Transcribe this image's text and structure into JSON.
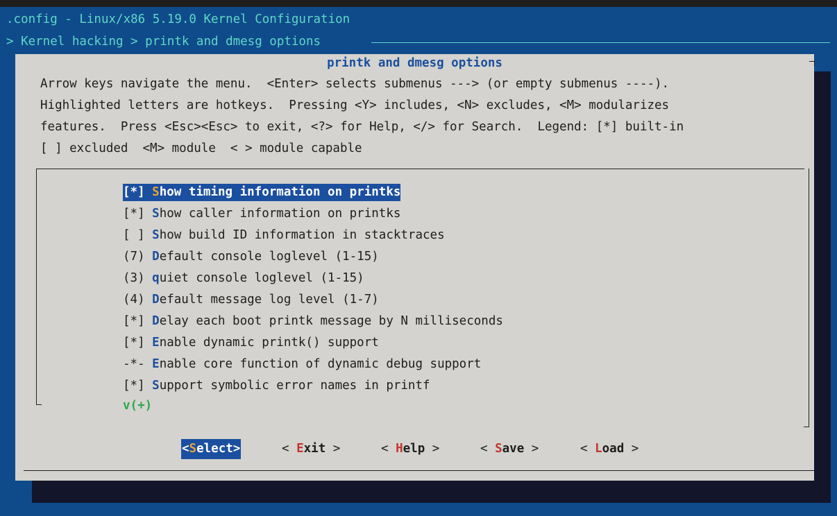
{
  "window": {
    "title": ".config - Linux/x86 5.19.0 Kernel Configuration",
    "breadcrumb": "> Kernel hacking > printk and dmesg options"
  },
  "dialog": {
    "title": "printk and dmesg options",
    "help_lines": [
      "Arrow keys navigate the menu.  <Enter> selects submenus ---> (or empty submenus ----).",
      "Highlighted letters are hotkeys.  Pressing <Y> includes, <N> excludes, <M> modularizes",
      "features.  Press <Esc><Esc> to exit, <?> for Help, </> for Search.  Legend: [*] built-in",
      "[ ] excluded  <M> module  < > module capable"
    ]
  },
  "menu": {
    "items": [
      {
        "prefix": "[*] ",
        "hotkey": "S",
        "rest": "how timing information on printks",
        "selected": true
      },
      {
        "prefix": "[*] ",
        "hotkey": "S",
        "rest": "how caller information on printks"
      },
      {
        "prefix": "[ ] ",
        "hotkey": "S",
        "rest": "how build ID information in stacktraces"
      },
      {
        "prefix": "(7) ",
        "hotkey": "D",
        "rest": "efault console loglevel (1-15)"
      },
      {
        "prefix": "(3) ",
        "hotkey": "q",
        "rest": "uiet console loglevel (1-15)"
      },
      {
        "prefix": "(4) ",
        "hotkey": "D",
        "rest": "efault message log level (1-7)"
      },
      {
        "prefix": "[*] ",
        "hotkey": "D",
        "rest": "elay each boot printk message by N milliseconds"
      },
      {
        "prefix": "[*] ",
        "hotkey": "E",
        "rest": "nable dynamic printk() support"
      },
      {
        "prefix": "-*- ",
        "hotkey": "E",
        "rest": "nable core function of dynamic debug support"
      },
      {
        "prefix": "[*] ",
        "hotkey": "S",
        "rest": "upport symbolic error names in printf"
      }
    ],
    "more_indicator": "v(+)"
  },
  "buttons": {
    "select": {
      "open": "<",
      "hotkey": "S",
      "rest": "elect",
      "close": ">"
    },
    "exit": {
      "open": "< ",
      "hotkey": "E",
      "rest": "xit",
      "close": " >"
    },
    "help": {
      "open": "< ",
      "hotkey": "H",
      "rest": "elp",
      "close": " >"
    },
    "save": {
      "open": "< ",
      "hotkey": "S",
      "rest": "ave",
      "close": " >"
    },
    "load": {
      "open": "< ",
      "hotkey": "L",
      "rest": "oad",
      "close": " >"
    }
  },
  "colors": {
    "screen_bg": "#0f4b8a",
    "dialog_bg": "#d4d3cf",
    "accent_blue": "#1b4f9f",
    "header_cyan": "#5fd7c8",
    "hotkey_red": "#c4342d",
    "highlight_orange": "#e8a23c",
    "more_green": "#2fa84f"
  }
}
